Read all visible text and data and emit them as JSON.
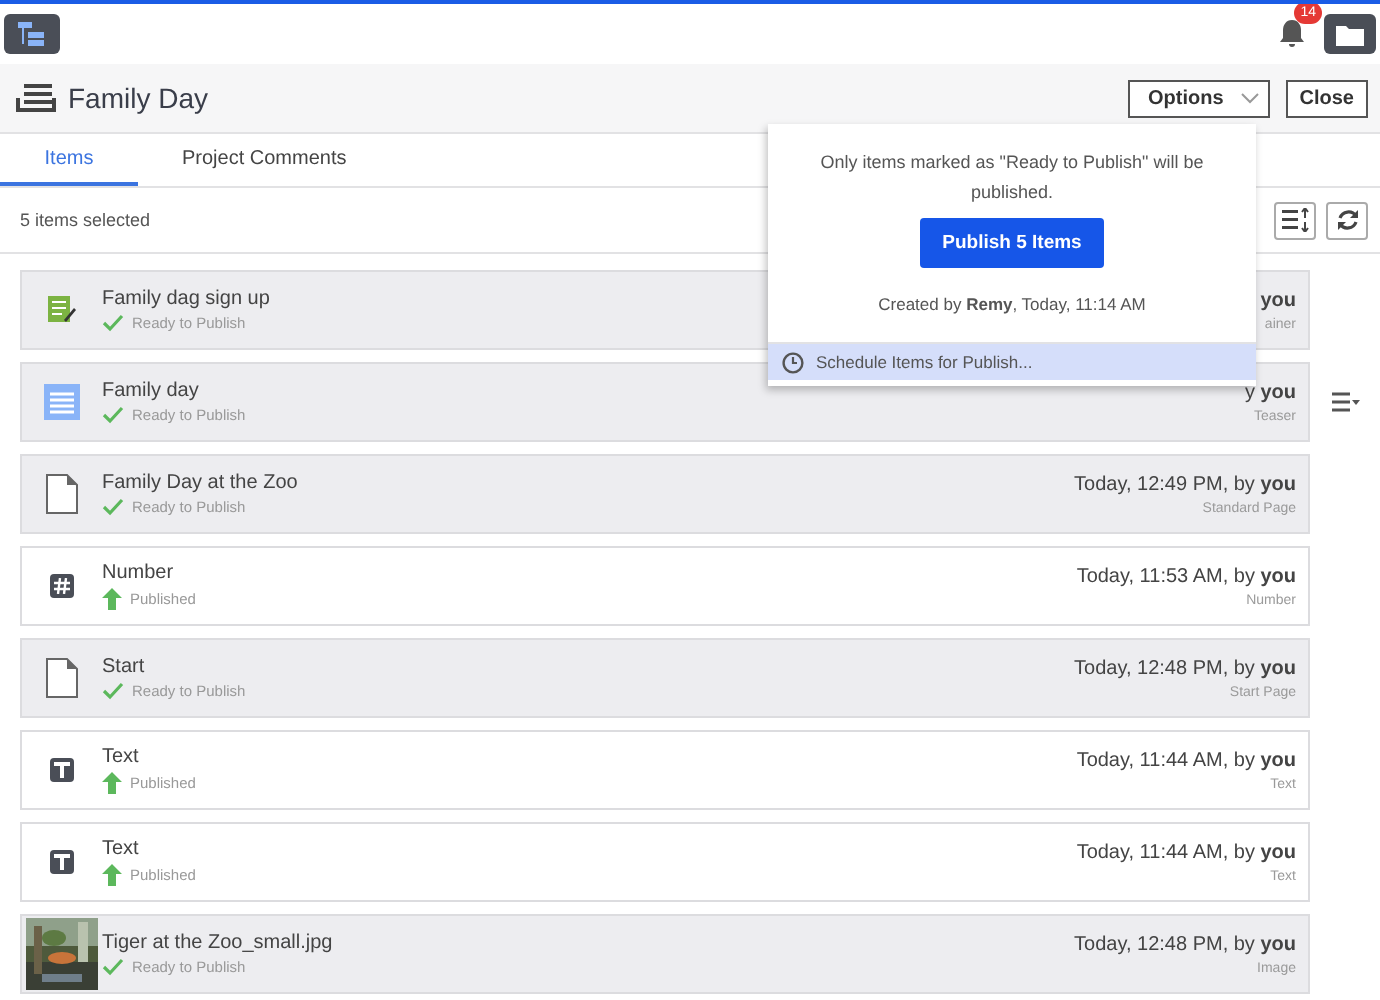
{
  "header": {
    "notification_count": "14"
  },
  "title": "Family Day",
  "actions": {
    "options": "Options",
    "close": "Close"
  },
  "tabs": [
    {
      "label": "Items",
      "selected": true
    },
    {
      "label": "Project Comments",
      "selected": false
    }
  ],
  "selection_summary": "5 items selected",
  "items": [
    {
      "kind": "form",
      "name": "Family dag sign up",
      "status": {
        "kind": "ready",
        "text": "Ready to Publish"
      },
      "modified": "**you**",
      "type": "ainer",
      "selected": true,
      "menu": false
    },
    {
      "kind": "teaser",
      "name": "Family day",
      "status": {
        "kind": "ready",
        "text": "Ready to Publish"
      },
      "modified": "y **you**",
      "type": "Teaser",
      "selected": true,
      "menu": true
    },
    {
      "kind": "page",
      "name": "Family Day at the Zoo",
      "status": {
        "kind": "ready",
        "text": "Ready to Publish"
      },
      "modified": "Today, 12:49 PM, by **you**",
      "type": "Standard Page",
      "selected": true,
      "menu": false
    },
    {
      "kind": "number",
      "name": "Number",
      "status": {
        "kind": "published",
        "text": "Published"
      },
      "modified": "Today, 11:53 AM, by **you**",
      "type": "Number",
      "selected": false,
      "menu": false
    },
    {
      "kind": "page",
      "name": "Start",
      "status": {
        "kind": "ready",
        "text": "Ready to Publish"
      },
      "modified": "Today, 12:48 PM, by **you**",
      "type": "Start Page",
      "selected": true,
      "menu": false
    },
    {
      "kind": "text",
      "name": "Text",
      "status": {
        "kind": "published",
        "text": "Published"
      },
      "modified": "Today, 11:44 AM, by **you**",
      "type": "Text",
      "selected": false,
      "menu": false
    },
    {
      "kind": "text",
      "name": "Text",
      "status": {
        "kind": "published",
        "text": "Published"
      },
      "modified": "Today, 11:44 AM, by **you**",
      "type": "Text",
      "selected": false,
      "menu": false
    },
    {
      "name": "Tiger at the Zoo_small.jpg",
      "status": {
        "kind": "ready",
        "text": "Ready to Publish"
      },
      "modified": "Today, 12:48 PM, by **you**",
      "type": "Image",
      "selected": true,
      "menu": false
    }
  ],
  "publish_popup": {
    "note": "Only items marked as \"Ready to Publish\" will be published.",
    "button": "Publish 5 Items",
    "created": "Created by **Remy**, Today, 11:14 AM",
    "menu_item": "Schedule Items for Publish..."
  }
}
